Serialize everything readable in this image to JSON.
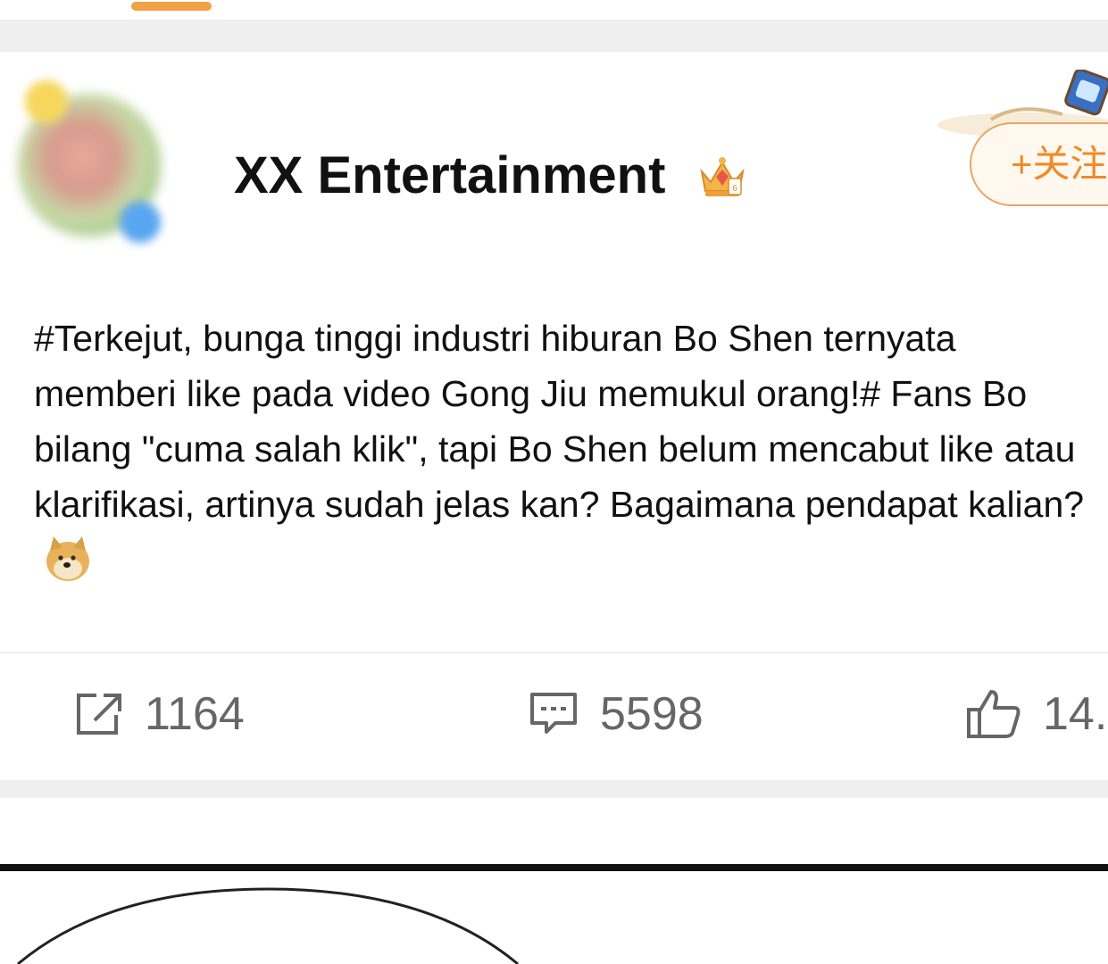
{
  "post": {
    "author_name": "XX Entertainment",
    "follow_label": "+关注",
    "body_text": "#Terkejut, bunga tinggi industri hiburan Bo Shen ternyata memberi like pada video Gong Jiu memukul orang!# Fans Bo bilang \"cuma salah klik\", tapi Bo Shen belum mencabut like atau klarifikasi, artinya sudah jelas kan? Bagaimana pendapat kalian?",
    "emoji": "doge-icon",
    "badge": "crown-icon"
  },
  "actions": {
    "repost": {
      "icon": "repost-icon",
      "count": "1164"
    },
    "comment": {
      "icon": "comment-icon",
      "count": "5598"
    },
    "like": {
      "icon": "thumbs-up-icon",
      "count": "14."
    }
  },
  "colors": {
    "accent": "#f08a2a",
    "tab_indicator": "#f2a044",
    "icon_gray": "#666666",
    "separator": "#efefef"
  }
}
